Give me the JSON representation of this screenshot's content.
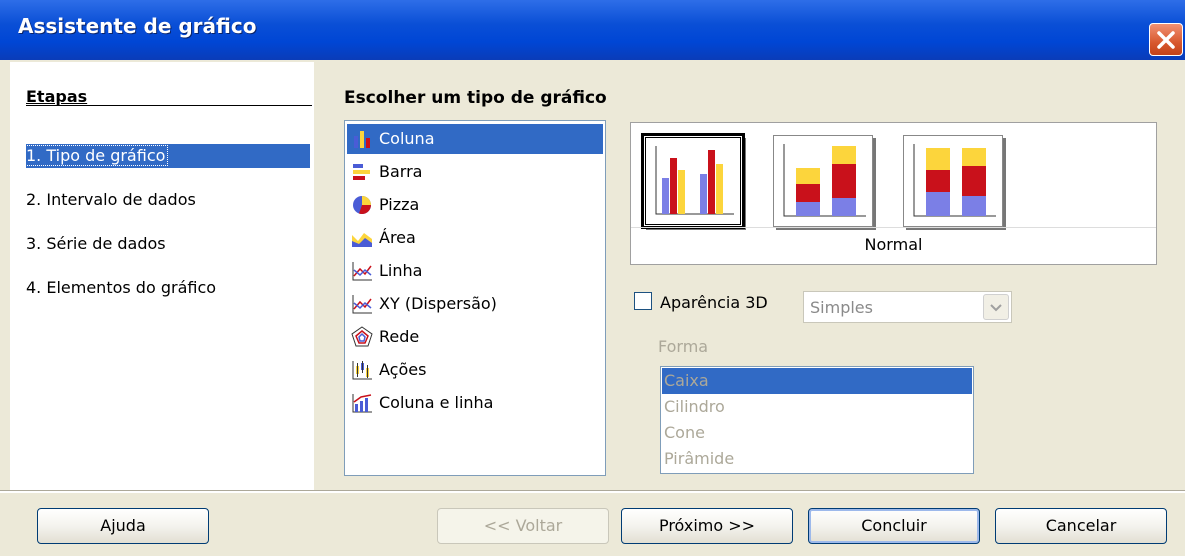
{
  "window": {
    "title": "Assistente de gráfico"
  },
  "steps": {
    "heading": "Etapas",
    "items": [
      "1. Tipo de gráfico",
      "2. Intervalo de dados",
      "3. Série de dados",
      "4. Elementos do gráfico"
    ],
    "selected": 0
  },
  "chart_type": {
    "heading": "Escolher um tipo de gráfico",
    "types": [
      "Coluna",
      "Barra",
      "Pizza",
      "Área",
      "Linha",
      "XY (Dispersão)",
      "Rede",
      "Ações",
      "Coluna e linha"
    ],
    "selected": 0,
    "icons": [
      "column-chart-icon",
      "bar-chart-icon",
      "pie-chart-icon",
      "area-chart-icon",
      "line-chart-icon",
      "xy-scatter-icon",
      "net-chart-icon",
      "stock-chart-icon",
      "column-line-chart-icon"
    ]
  },
  "variant": {
    "label": "Normal",
    "options": [
      "normal",
      "stacked",
      "percent-stacked"
    ],
    "selected": 0
  },
  "appearance_3d": {
    "label": "Aparência 3D",
    "checked": false,
    "value": "Simples"
  },
  "shape": {
    "label": "Forma",
    "options": [
      "Caixa",
      "Cilindro",
      "Cone",
      "Pirâmide"
    ],
    "selected": 0
  },
  "buttons": {
    "help": "Ajuda",
    "back": "<< Voltar",
    "next": "Próximo >>",
    "finish": "Concluir",
    "cancel": "Cancelar"
  },
  "colors": {
    "accent": "#316ac5",
    "title_bar": "#0046d5",
    "bar_red": "#c9111b",
    "bar_yellow": "#fcd53c",
    "bar_blue": "#7b7fe6"
  }
}
